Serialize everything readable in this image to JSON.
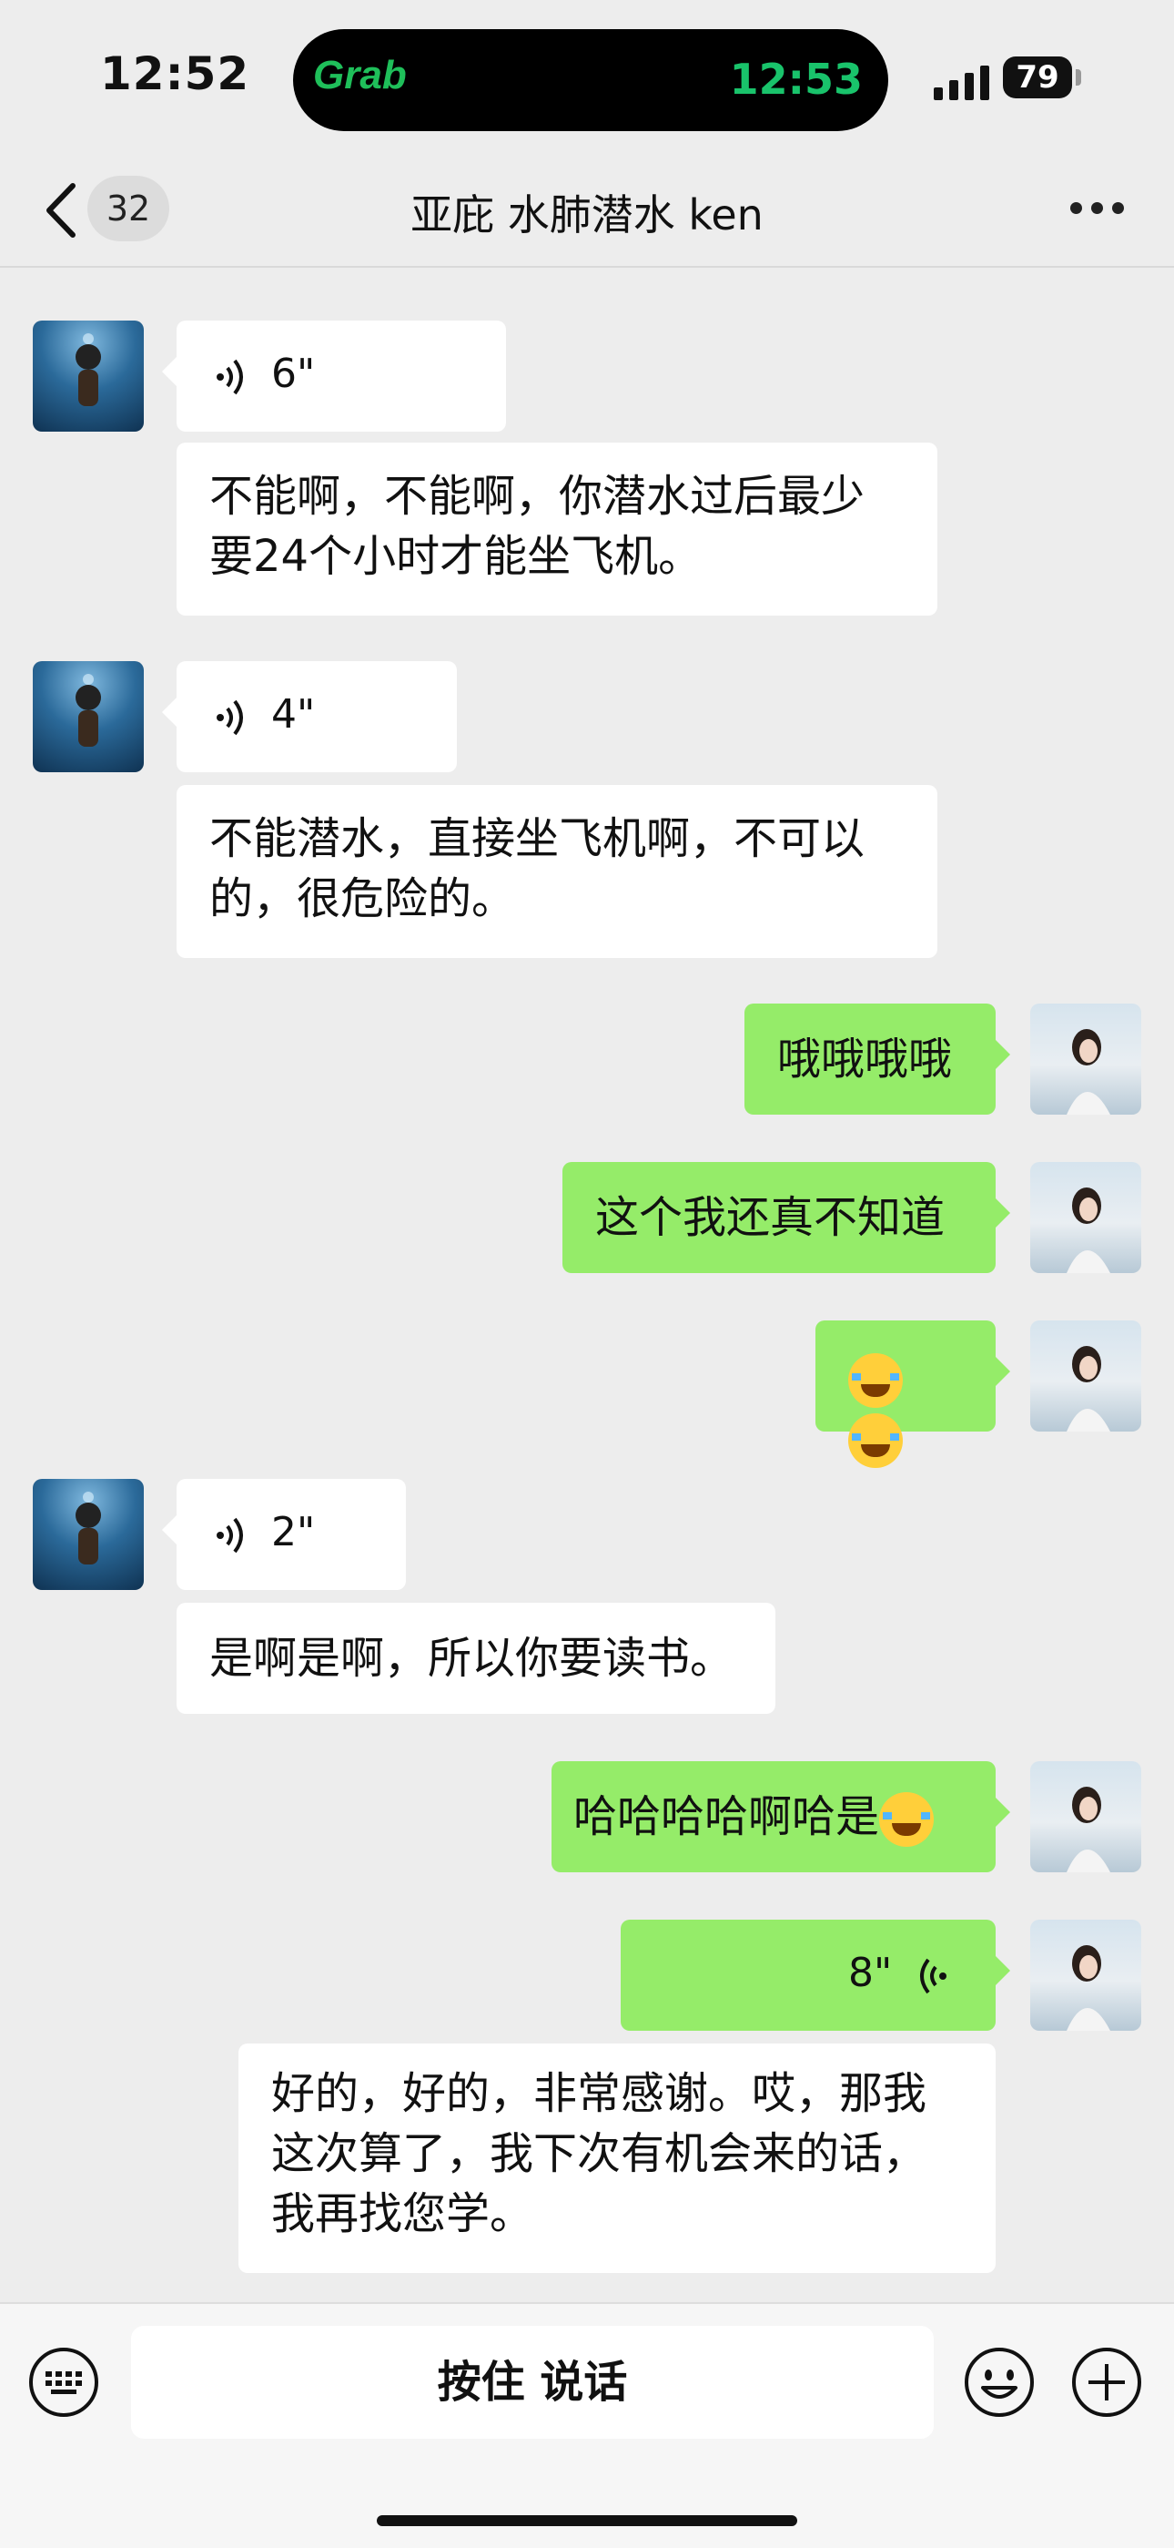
{
  "status_bar": {
    "time": "12:52",
    "island_app": "Grab",
    "island_time": "12:53",
    "battery": "79"
  },
  "header": {
    "unread_count": "32",
    "title": "亚庇 水肺潜水 ken"
  },
  "messages": [
    {
      "side": "left",
      "type": "voice",
      "duration": "6\""
    },
    {
      "side": "left",
      "type": "text",
      "lines": [
        "不能啊，不能啊，你潜水过后最少",
        "要24个小时才能坐飞机。"
      ]
    },
    {
      "side": "left",
      "type": "voice",
      "duration": "4\""
    },
    {
      "side": "left",
      "type": "text",
      "lines": [
        "不能潜水，直接坐飞机啊，不可以",
        "的，很危险的。"
      ]
    },
    {
      "side": "right",
      "type": "text",
      "lines": [
        "哦哦哦哦"
      ]
    },
    {
      "side": "right",
      "type": "text",
      "lines": [
        "这个我还真不知道"
      ]
    },
    {
      "side": "right",
      "type": "emoji",
      "emoji": "face-with-tears-of-joy",
      "count": 2
    },
    {
      "side": "left",
      "type": "voice",
      "duration": "2\""
    },
    {
      "side": "left",
      "type": "text",
      "lines": [
        "是啊是啊，所以你要读书。"
      ]
    },
    {
      "side": "right",
      "type": "text",
      "lines": [
        "哈哈哈哈啊哈是"
      ],
      "trailing_emoji": "face-with-tears-of-joy"
    },
    {
      "side": "right",
      "type": "voice",
      "duration": "8\""
    },
    {
      "side": "right",
      "type": "transcript",
      "lines": [
        "好的，好的，非常感谢。哎，那我",
        "这次算了，我下次有机会来的话，",
        "我再找您学。"
      ]
    }
  ],
  "input_bar": {
    "hold_to_talk": "按住 说话"
  },
  "colors": {
    "sent_bubble": "#95ec69",
    "received_bubble": "#ffffff",
    "background": "#ededed",
    "grab_green": "#1fbf5a"
  },
  "icons": [
    "back-chevron-icon",
    "more-dots-icon",
    "voice-wave-icon",
    "keyboard-icon",
    "emoji-face-icon",
    "plus-circle-icon",
    "signal-icon",
    "battery-icon"
  ]
}
